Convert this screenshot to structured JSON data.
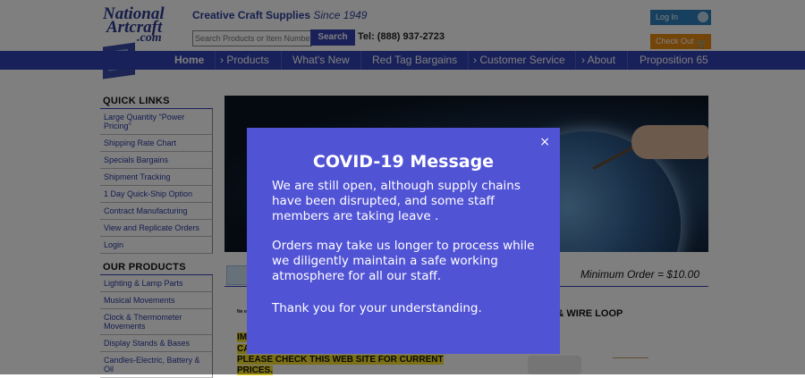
{
  "header": {
    "logo": {
      "line1": "National",
      "line2": "Artcraft",
      "line3": ".com"
    },
    "tagline": "Creative Craft Supplies",
    "since": "Since 1949",
    "search_placeholder": "Search Products or Item Numbers",
    "search_button": "Search",
    "phone": "Tel: (888) 937-2723",
    "login_label": "Log In",
    "checkout_label": "Check Out"
  },
  "nav": {
    "items": [
      {
        "label": "Home"
      },
      {
        "label": "Products"
      },
      {
        "label": "What's New"
      },
      {
        "label": "Red Tag Bargains"
      },
      {
        "label": "Customer Service"
      },
      {
        "label": "About"
      },
      {
        "label": "Proposition 65"
      }
    ]
  },
  "quick_links": {
    "title": "QUICK LINKS",
    "items": [
      "Large Quantity \"Power Pricing\"",
      "Shipping Rate Chart",
      "Specials Bargains",
      "Shipment Tracking",
      "1 Day Quick-Ship Option",
      "Contract Manufacturing",
      "View and Replicate Orders",
      "Login"
    ]
  },
  "our_products": {
    "title": "OUR PRODUCTS",
    "items": [
      "Lighting & Lamp Parts",
      "Musical Movements",
      "Clock & Thermometer Movements",
      "Display Stands & Bases",
      "Candles-Electric, Battery & Oil"
    ]
  },
  "main": {
    "min_order": "Minimum Order = $10.00",
    "notice_1": "IM",
    "notice_2": "CA",
    "notice_3": "PLEASE CHECK THIS WEB SITE FOR CURRENT",
    "notice_4": "PRICES.",
    "small_note": "Ne or",
    "product_title": "S & WIRE LOOP"
  },
  "modal": {
    "title": "COVID-19 Message",
    "close": "×",
    "paragraph_1": "We are still open, although supply chains have been disrupted, and some staff members are taking leave .",
    "paragraph_2": "Orders may take us longer to process while we diligently maintain a safe working atmosphere for all our staff.",
    "paragraph_3": "Thank you for your understanding."
  },
  "colors": {
    "nav_bg": "#3242b4",
    "modal_bg": "#5153d5",
    "login_bg": "#2f80bd",
    "checkout_bg": "#e68a12",
    "highlight": "#f6e12a"
  }
}
